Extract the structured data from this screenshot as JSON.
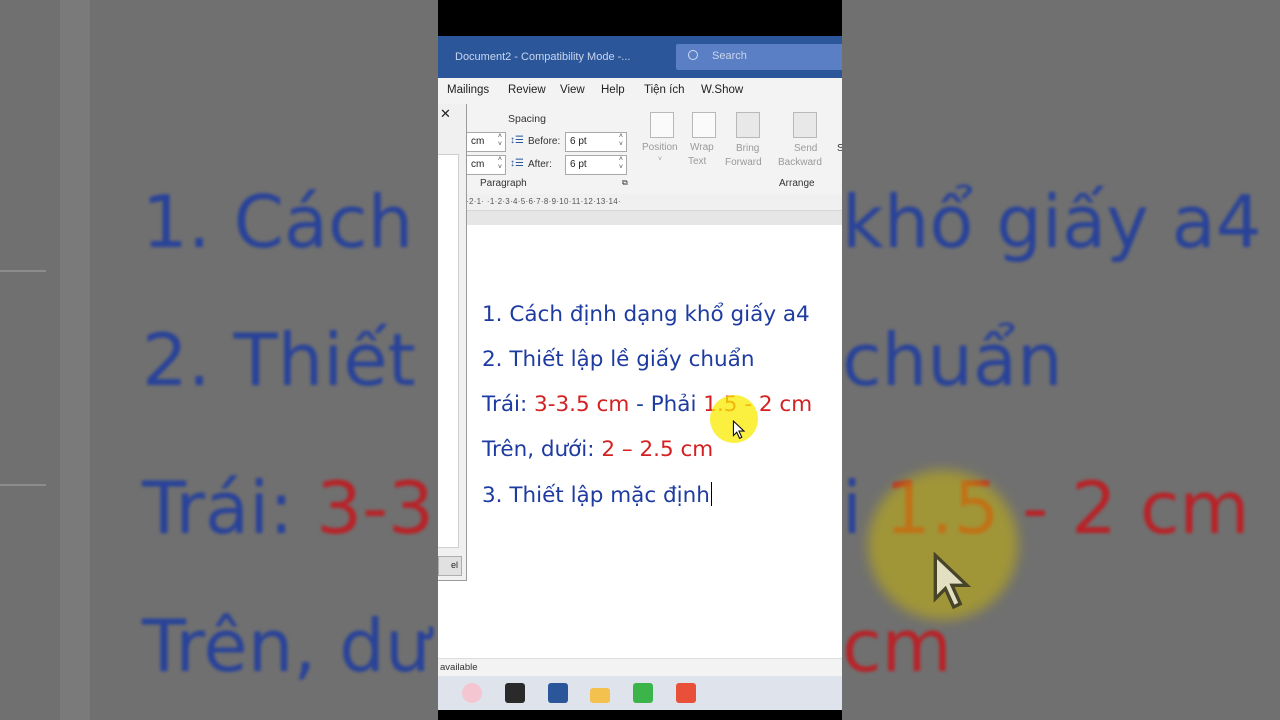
{
  "background": {
    "lines": [
      {
        "parts": [
          {
            "text": "1.  Cách",
            "red": false
          }
        ]
      },
      {
        "parts": [
          {
            "text": "khổ giấy a4",
            "red": false
          }
        ]
      },
      {
        "parts": [
          {
            "text": "2.  Thiết",
            "red": false
          }
        ]
      },
      {
        "parts": [
          {
            "text": "chuẩn",
            "red": false
          }
        ]
      },
      {
        "parts": [
          {
            "text": "Trái: ",
            "red": false
          },
          {
            "text": "3-3,",
            "red": true
          }
        ]
      },
      {
        "parts": [
          {
            "text": "i ",
            "red": false
          },
          {
            "text": "1.5 - 2 cm",
            "red": true
          }
        ]
      },
      {
        "parts": [
          {
            "text": "Trên, dư",
            "red": false
          }
        ]
      },
      {
        "parts": [
          {
            "text": "cm",
            "red": true
          }
        ]
      }
    ]
  },
  "window": {
    "title": "Document2  -  Compatibility Mode  -...",
    "search_placeholder": "Search"
  },
  "menu": [
    "Mailings",
    "Review",
    "View",
    "Help",
    "Tiện ích",
    "W.Show"
  ],
  "ribbon": {
    "spacing_label": "Spacing",
    "indent_unit_1": "cm",
    "indent_unit_2": "cm",
    "before_label": "Before:",
    "before_value": "6 pt",
    "after_label": "After:",
    "after_value": "6 pt",
    "paragraph_group": "Paragraph",
    "position": "Position",
    "wrap_text_1": "Wrap",
    "wrap_text_2": "Text",
    "bring_forward_1": "Bring",
    "bring_forward_2": "Forward",
    "send_backward_1": "Send",
    "send_backward_2": "Backward",
    "arrange_group": "Arrange",
    "cut_letter": "S"
  },
  "ruler": "·2·1· ·1·2·3·4·5·6·7·8·9·10·11·12·13·14·",
  "document": {
    "line1": "1.  Cách định dạng khổ giấy a4",
    "line2": "2.  Thiết lập lề giấy chuẩn",
    "line3_label": "Trái: ",
    "line3_val1": "3-3.5 cm",
    "line3_mid": " - Phải ",
    "line3_val2": "1.5 - 2 cm",
    "line4_label": "Trên, dưới: ",
    "line4_val": "2 – 2.5 cm",
    "line5": "3.  Thiết lập mặc định"
  },
  "status": "available",
  "dialog": {
    "close": "✕",
    "cancel_fragment": "el"
  },
  "taskbar_icons": [
    "snipping-tool-icon",
    "sticky-notes-icon",
    "word-icon",
    "file-explorer-icon",
    "camtasia-green-icon",
    "camtasia-red-icon"
  ]
}
